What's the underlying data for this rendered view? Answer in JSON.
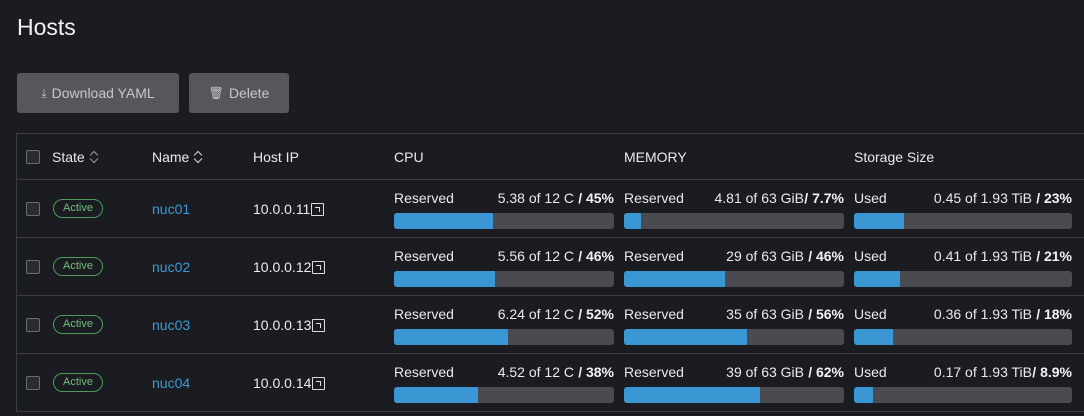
{
  "page": {
    "title": "Hosts"
  },
  "toolbar": {
    "download_label": "Download YAML",
    "download_icon": "download-icon",
    "delete_label": "Delete",
    "delete_icon": "trash-icon"
  },
  "table": {
    "headers": {
      "state": "State",
      "name": "Name",
      "host_ip": "Host IP",
      "cpu": "CPU",
      "memory": "MEMORY",
      "storage": "Storage Size"
    },
    "rows": [
      {
        "state": "Active",
        "name": "nuc01",
        "ip": "10.0.0.11",
        "cpu": {
          "label": "Reserved",
          "value": "5.38 of 12 C",
          "pct": "/ 45%",
          "fraction": 0.45
        },
        "mem": {
          "label": "Reserved",
          "value": "4.81 of 63 GiB",
          "pct": "/ 7.7%",
          "fraction": 0.077
        },
        "sto": {
          "label": "Used",
          "value": "0.45 of 1.93 TiB",
          "pct": "/ 23%",
          "fraction": 0.23
        }
      },
      {
        "state": "Active",
        "name": "nuc02",
        "ip": "10.0.0.12",
        "cpu": {
          "label": "Reserved",
          "value": "5.56 of 12 C",
          "pct": "/ 46%",
          "fraction": 0.46
        },
        "mem": {
          "label": "Reserved",
          "value": "29 of 63 GiB",
          "pct": "/ 46%",
          "fraction": 0.46
        },
        "sto": {
          "label": "Used",
          "value": "0.41 of 1.93 TiB",
          "pct": "/ 21%",
          "fraction": 0.21
        }
      },
      {
        "state": "Active",
        "name": "nuc03",
        "ip": "10.0.0.13",
        "cpu": {
          "label": "Reserved",
          "value": "6.24 of 12 C",
          "pct": "/ 52%",
          "fraction": 0.52
        },
        "mem": {
          "label": "Reserved",
          "value": "35 of 63 GiB",
          "pct": "/ 56%",
          "fraction": 0.56
        },
        "sto": {
          "label": "Used",
          "value": "0.36 of 1.93 TiB",
          "pct": "/ 18%",
          "fraction": 0.18
        }
      },
      {
        "state": "Active",
        "name": "nuc04",
        "ip": "10.0.0.14",
        "cpu": {
          "label": "Reserved",
          "value": "4.52 of 12 C",
          "pct": "/ 38%",
          "fraction": 0.38
        },
        "mem": {
          "label": "Reserved",
          "value": "39 of 63 GiB",
          "pct": "/ 62%",
          "fraction": 0.62
        },
        "sto": {
          "label": "Used",
          "value": "0.17 of 1.93 TiB",
          "pct": "/ 8.9%",
          "fraction": 0.089
        }
      }
    ]
  },
  "colors": {
    "background": "#1b1c21",
    "accent": "#3b97d3",
    "link": "#3d98d3",
    "active_badge": "#6fbf78",
    "bar_track": "#4a4b50"
  }
}
